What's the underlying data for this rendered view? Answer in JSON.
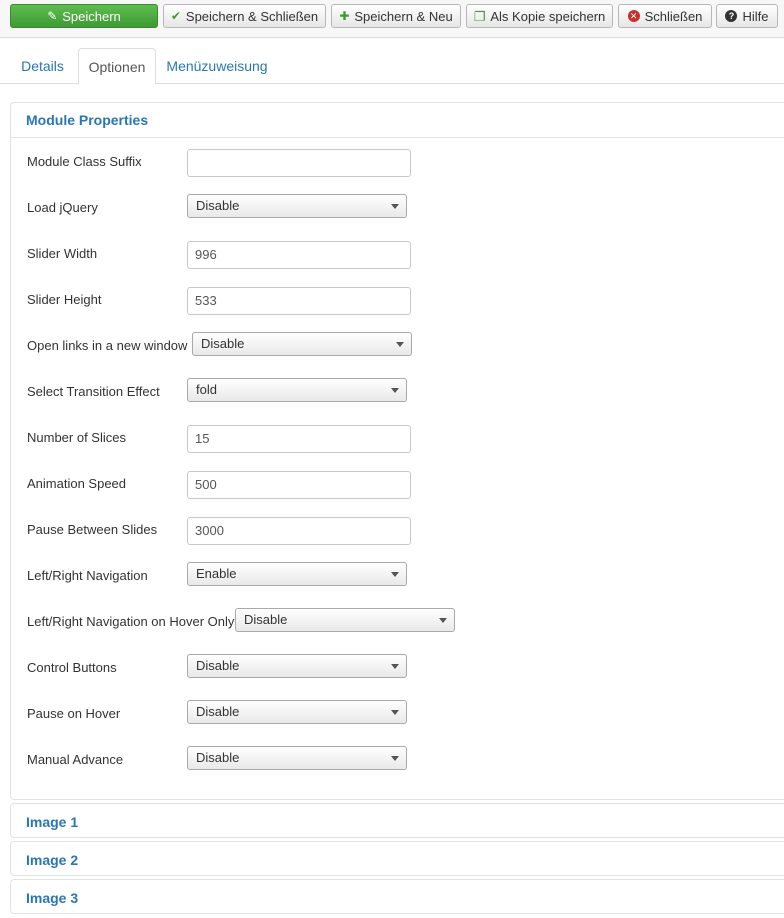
{
  "toolbar": {
    "save": "Speichern",
    "save_close": "Speichern & Schließen",
    "save_new": "Speichern & Neu",
    "save_copy": "Als Kopie speichern",
    "close": "Schließen",
    "help": "Hilfe"
  },
  "tabs": [
    "Details",
    "Optionen",
    "Menüzuweisung"
  ],
  "active_tab": "Optionen",
  "panel": {
    "title": "Module Properties",
    "fields": {
      "class_suffix": {
        "label": "Module Class Suffix",
        "value": ""
      },
      "load_jquery": {
        "label": "Load jQuery",
        "value": "Disable"
      },
      "slider_width": {
        "label": "Slider Width",
        "value": "996"
      },
      "slider_height": {
        "label": "Slider Height",
        "value": "533"
      },
      "open_links": {
        "label": "Open links in a new window",
        "value": "Disable"
      },
      "transition": {
        "label": "Select Transition Effect",
        "value": "fold"
      },
      "slices": {
        "label": "Number of Slices",
        "value": "15"
      },
      "anim_speed": {
        "label": "Animation Speed",
        "value": "500"
      },
      "pause_between": {
        "label": "Pause Between Slides",
        "value": "3000"
      },
      "lr_nav": {
        "label": "Left/Right Navigation",
        "value": "Enable"
      },
      "lr_nav_hover": {
        "label": "Left/Right Navigation on Hover Only",
        "value": "Disable"
      },
      "control_buttons": {
        "label": "Control Buttons",
        "value": "Disable"
      },
      "pause_hover": {
        "label": "Pause on Hover",
        "value": "Disable"
      },
      "manual_advance": {
        "label": "Manual Advance",
        "value": "Disable"
      }
    }
  },
  "collapsed_panels": [
    "Image 1",
    "Image 2",
    "Image 3"
  ],
  "colors": {
    "accent": "#2a76b5",
    "primary_button": "#4cae3f"
  }
}
